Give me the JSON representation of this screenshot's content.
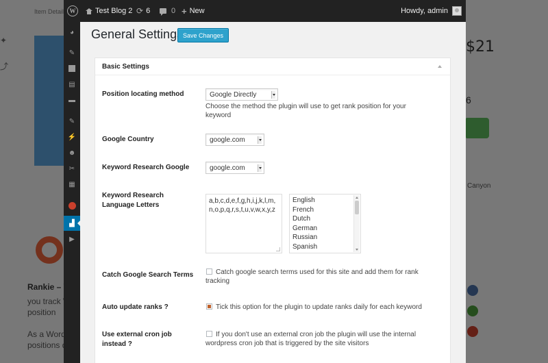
{
  "background": {
    "breadcrumb": "Item Details",
    "price": "$21",
    "count": "6",
    "location": "Canyon",
    "title": "Rankie – W",
    "lines": [
      "you track W",
      "position",
      "As a Word",
      "positions d"
    ]
  },
  "adminbar": {
    "site_name": "Test Blog 2",
    "updates_count": "6",
    "comments_count": "0",
    "new_label": "New",
    "howdy": "Howdy, admin"
  },
  "page": {
    "title": "General Settings",
    "save_label": "Save Changes"
  },
  "section": {
    "title": "Basic Settings"
  },
  "settings": {
    "position_method": {
      "label": "Position locating method",
      "value": "Google Directly",
      "description": "Choose the method the plugin will use to get rank position for your keyword"
    },
    "google_country": {
      "label": "Google Country",
      "value": "google.com"
    },
    "keyword_research_google": {
      "label": "Keyword Research Google",
      "value": "google.com"
    },
    "language_letters": {
      "label": "Keyword Research Language Letters",
      "letters": "a,b,c,d,e,f,g,h,i,j,k,l,m,n,o,p,q,r,s,t,u,v,w,x,y,z",
      "languages": [
        "English",
        "French",
        "Dutch",
        "German",
        "Russian",
        "Spanish"
      ]
    },
    "catch_terms": {
      "label": "Catch Google Search Terms",
      "checked": false,
      "text": "Catch google search terms used for this site and add them for rank tracking"
    },
    "auto_update": {
      "label": "Auto update ranks ?",
      "checked": true,
      "text": "Tick this option for the plugin to update ranks daily for each keyword"
    },
    "external_cron": {
      "label": "Use external cron job instead ?",
      "checked": false,
      "text": "If you don't use an external cron job the plugin will use the internal wordpress cron job that is triggered by the site visitors"
    }
  },
  "colors": {
    "adminbar": "#222222",
    "primary_button": "#2ea2cc",
    "active_menu": "#0073aa"
  }
}
